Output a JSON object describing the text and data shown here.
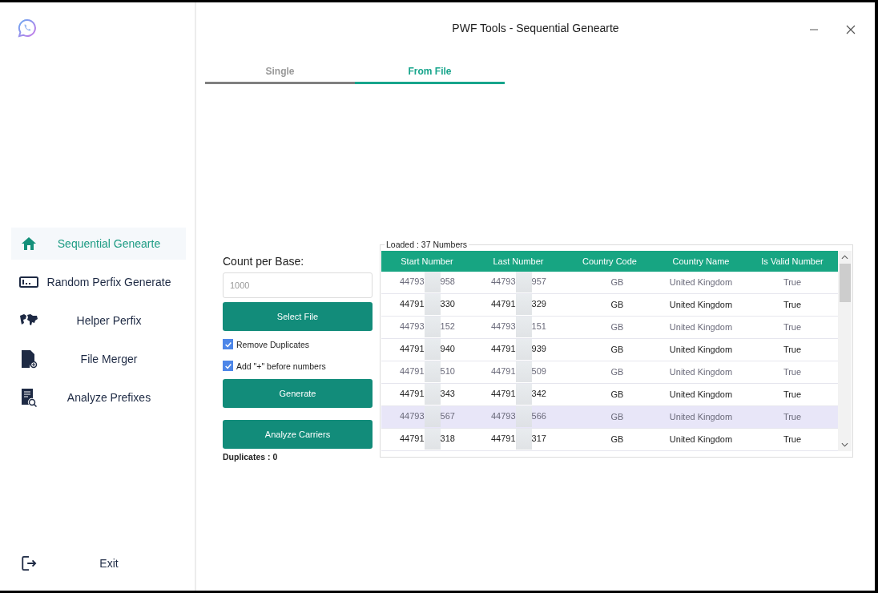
{
  "window": {
    "title": "PWF Tools - Sequential Genearte"
  },
  "sidebar": {
    "items": [
      {
        "label": "Sequential Genearte",
        "selected": true
      },
      {
        "label": "Random Perfix Generate",
        "selected": false
      },
      {
        "label": "Helper Perfix",
        "selected": false
      },
      {
        "label": "File Merger",
        "selected": false
      },
      {
        "label": "Analyze Prefixes",
        "selected": false
      }
    ],
    "exit": "Exit"
  },
  "tabs": [
    {
      "label": "Single",
      "selected": false
    },
    {
      "label": "From File",
      "selected": true
    }
  ],
  "form": {
    "count_label": "Count per Base:",
    "count_placeholder": "1000",
    "select_file": "Select File",
    "options": [
      {
        "label": "Remove Duplicates",
        "checked": true
      },
      {
        "label": "Add \"+\" before numbers",
        "checked": true
      }
    ],
    "generate": "Generate",
    "analyze": "Analyze Carriers",
    "duplicates": "Duplicates : 0"
  },
  "table": {
    "legend": "Loaded : 37 Numbers",
    "columns": [
      "Start Number",
      "Last Number",
      "Country Code",
      "Country Name",
      "Is Valid Number"
    ],
    "rows": [
      {
        "start": [
          "44793",
          "958"
        ],
        "last": [
          "44793",
          "957"
        ],
        "code": "GB",
        "name": "United Kingdom",
        "valid": "True",
        "selected": false
      },
      {
        "start": [
          "44791",
          "330"
        ],
        "last": [
          "44791",
          "329"
        ],
        "code": "GB",
        "name": "United Kingdom",
        "valid": "True",
        "selected": false
      },
      {
        "start": [
          "44793",
          "152"
        ],
        "last": [
          "44793",
          "151"
        ],
        "code": "GB",
        "name": "United Kingdom",
        "valid": "True",
        "selected": false
      },
      {
        "start": [
          "44791",
          "940"
        ],
        "last": [
          "44791",
          "939"
        ],
        "code": "GB",
        "name": "United Kingdom",
        "valid": "True",
        "selected": false
      },
      {
        "start": [
          "44791",
          "510"
        ],
        "last": [
          "44791",
          "509"
        ],
        "code": "GB",
        "name": "United Kingdom",
        "valid": "True",
        "selected": false
      },
      {
        "start": [
          "44791",
          "343"
        ],
        "last": [
          "44791",
          "342"
        ],
        "code": "GB",
        "name": "United Kingdom",
        "valid": "True",
        "selected": false
      },
      {
        "start": [
          "44793",
          "567"
        ],
        "last": [
          "44793",
          "566"
        ],
        "code": "GB",
        "name": "United Kingdom",
        "valid": "True",
        "selected": true
      },
      {
        "start": [
          "44791",
          "318"
        ],
        "last": [
          "44791",
          "317"
        ],
        "code": "GB",
        "name": "United Kingdom",
        "valid": "True",
        "selected": false
      }
    ]
  }
}
